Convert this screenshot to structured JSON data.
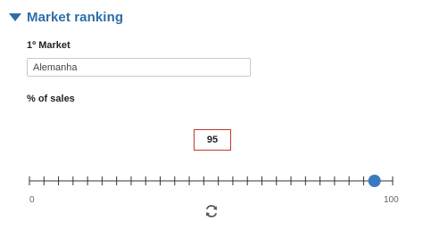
{
  "section": {
    "title": "Market ranking",
    "expanded": true
  },
  "market": {
    "label": "1º Market",
    "value": "Alemanha"
  },
  "sales": {
    "label": "% of sales",
    "value": 95,
    "value_text": "95",
    "min": 0,
    "max": 100,
    "min_label": "0",
    "max_label": "100",
    "tick_step": 4
  },
  "colors": {
    "accent": "#2e6ea6",
    "handle": "#3a7bbf",
    "value_border": "#c0392b"
  },
  "icons": {
    "collapse": "triangle-down-icon",
    "reset": "refresh-icon"
  }
}
